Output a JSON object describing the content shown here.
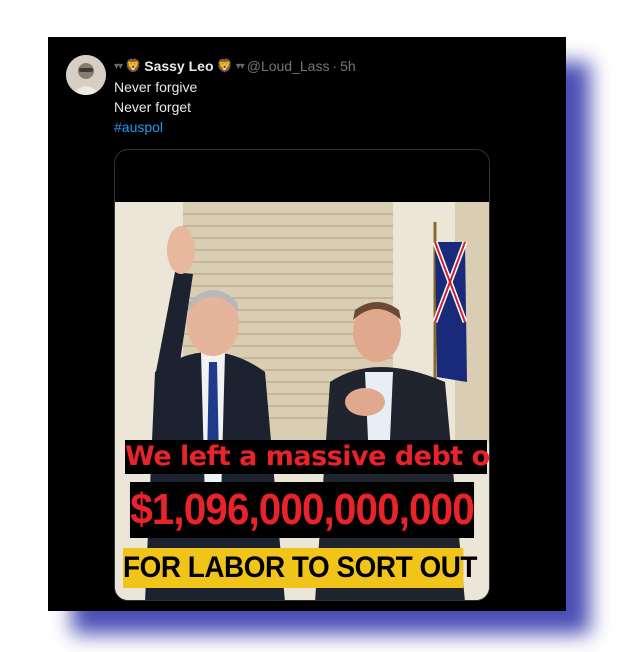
{
  "tweet": {
    "display_name": "Sassy Leo",
    "handle": "@Loud_Lass",
    "time": "5h",
    "separator": "·",
    "lines": [
      "Never forgive",
      "Never forget"
    ],
    "hashtag": "#auspol",
    "decorations": {
      "dots": "▾▾",
      "emoji": "🦁"
    }
  },
  "media": {
    "line1": "We left a massive debt of",
    "line2": "$1,096,000,000,000",
    "line3": "FOR LABOR TO SORT OUT"
  },
  "colors": {
    "card_bg": "#000000",
    "frame_shadow": "#2b2ea8",
    "hashtag": "#1d9bf0",
    "meme_red": "#e8232a",
    "meme_yellow": "#f0c419"
  }
}
